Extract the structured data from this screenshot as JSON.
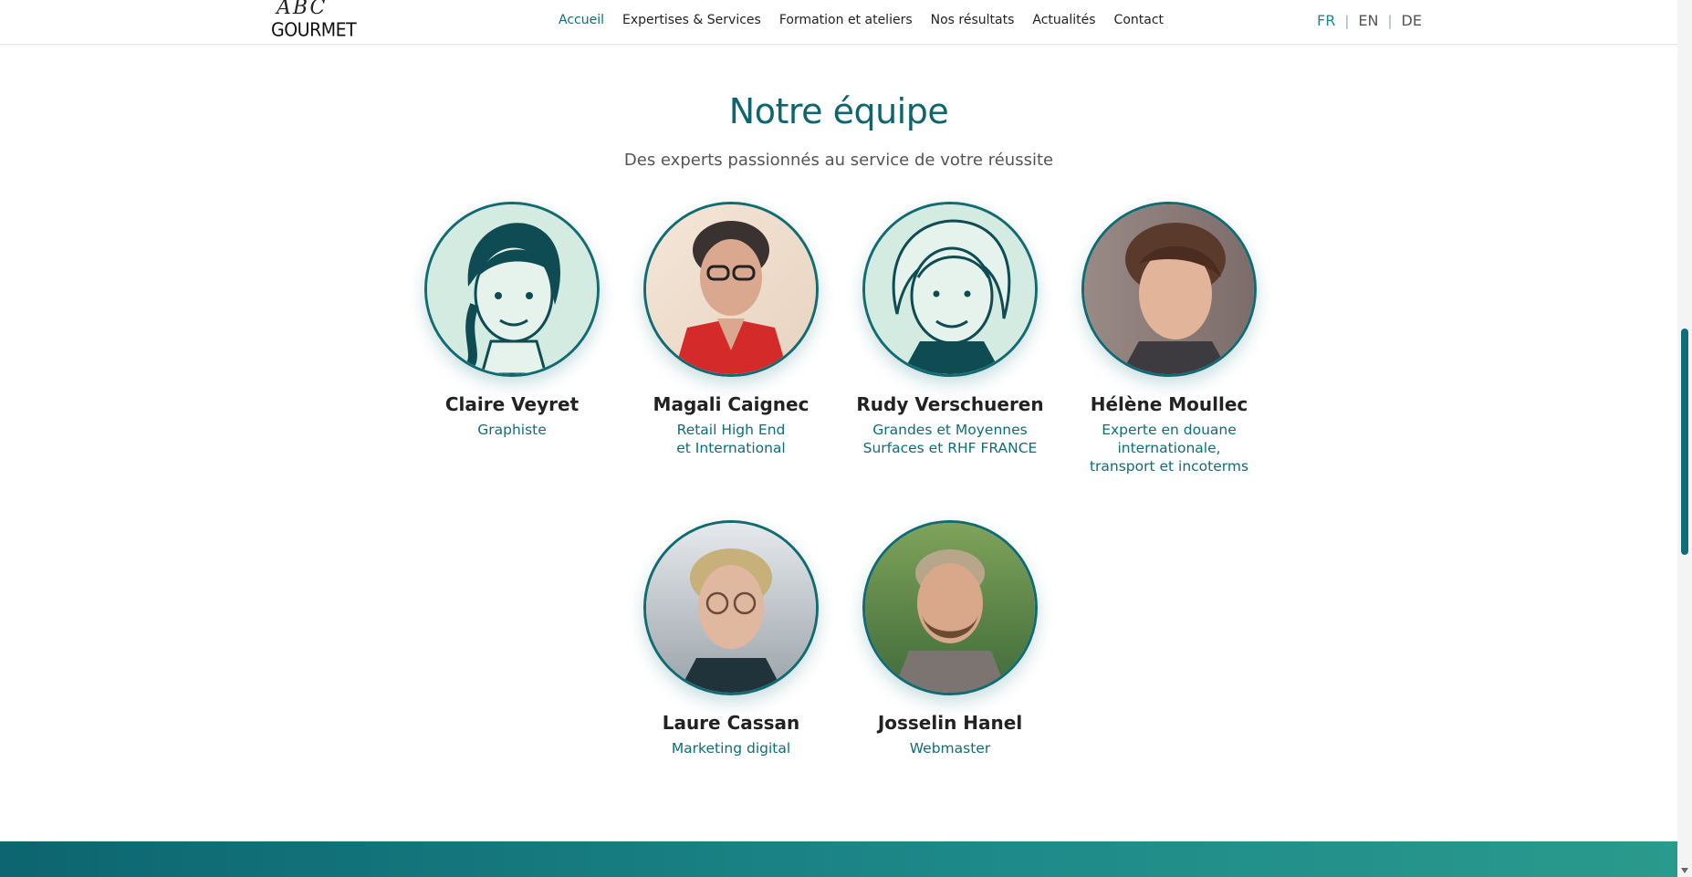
{
  "header": {
    "logo_top": "ABC",
    "logo_bottom": "GOURMET",
    "nav": [
      "Accueil",
      "Expertises & Services",
      "Formation et ateliers",
      "Nos résultats",
      "Actualités",
      "Contact"
    ],
    "languages": [
      "FR",
      "EN",
      "DE"
    ],
    "active_language": "FR",
    "active_nav": "Accueil"
  },
  "team": {
    "title": "Notre équipe",
    "subtitle": "Des experts passionnés au service de votre réussite",
    "members": [
      {
        "name": "Claire Veyret",
        "role": "Graphiste"
      },
      {
        "name": "Magali Caignec",
        "role": "Retail High End\net International"
      },
      {
        "name": "Rudy Verschueren",
        "role": "Grandes et Moyennes\nSurfaces et RHF FRANCE"
      },
      {
        "name": "Hélène Moullec",
        "role": "Experte en douane\ninternationale,\ntransport et incoterms"
      },
      {
        "name": "Laure Cassan",
        "role": "Marketing digital"
      },
      {
        "name": "Josselin Hanel",
        "role": "Webmaster"
      }
    ]
  },
  "colors": {
    "accent": "#0e6e78",
    "avatar_bg": "#d4ebe1",
    "band_start": "#0c6570",
    "band_end": "#2a9a8c"
  }
}
